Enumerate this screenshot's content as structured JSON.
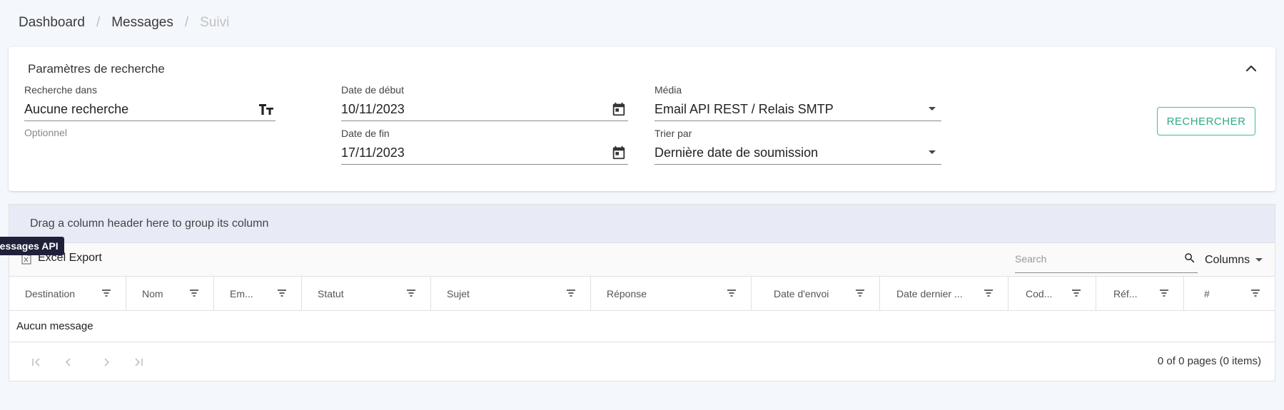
{
  "breadcrumb": {
    "items": [
      "Dashboard",
      "Messages"
    ],
    "separator": "/",
    "current": "Suivi"
  },
  "search_params": {
    "title": "Paramètres de recherche",
    "search_in": {
      "label": "Recherche dans",
      "value": "Aucune recherche",
      "hint": "Optionnel",
      "icon": "text-size-icon"
    },
    "start_date": {
      "label": "Date de début",
      "value": "10/11/2023",
      "icon": "calendar-icon"
    },
    "end_date": {
      "label": "Date de fin",
      "value": "17/11/2023",
      "icon": "calendar-icon"
    },
    "media": {
      "label": "Média",
      "value": "Email API REST / Relais SMTP"
    },
    "sort_by": {
      "label": "Trier par",
      "value": "Dernière date de soumission"
    },
    "search_button": "RECHERCHER"
  },
  "grid": {
    "group_panel_text": "Drag a column header here to group its column",
    "excel_export": "Excel Export",
    "tooltip": "Messages API",
    "search_placeholder": "Search",
    "columns_button": "Columns",
    "columns": [
      "Destination",
      "Nom",
      "Em...",
      "Statut",
      "Sujet",
      "Réponse",
      "Date d'envoi",
      "Date dernier ...",
      "Cod...",
      "Réf...",
      "#"
    ],
    "empty_text": "Aucun message",
    "pager_info": "0 of 0 pages (0 items)"
  },
  "colors": {
    "background": "#f4f7fc",
    "accent_green": "#2fa987",
    "group_panel": "#e8eaf6",
    "tooltip_bg": "#1f2139"
  }
}
